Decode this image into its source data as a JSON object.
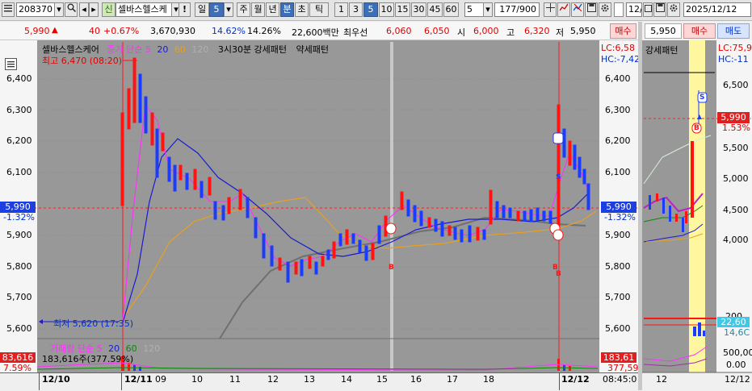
{
  "toolbar": {
    "code": "208370",
    "stock_name": "셀바스헬스케",
    "bang": "!",
    "period_options": [
      "일",
      "5",
      "주",
      "월",
      "년",
      "분",
      "초",
      "틱"
    ],
    "period_selected": "5",
    "minute_options": [
      "1",
      "3",
      "5",
      "10",
      "15",
      "30",
      "45",
      "60"
    ],
    "minute_selected": "5",
    "interval_value": "5",
    "count": "177/900",
    "right_input": "12/",
    "date": "2025/12/12"
  },
  "quote": {
    "price": "5,990",
    "change": "40",
    "change_pct": "+0.67%",
    "volume": "3,670,930",
    "rate1": "14.62%",
    "rate2": "14.26%",
    "amount": "22,600백만",
    "best_label": "최우선",
    "best_ask": "6,060",
    "best_bid": "6,050",
    "open_label": "시",
    "open": "6,000",
    "high_label": "고",
    "high": "6,320",
    "low_label": "저",
    "low": "5,950",
    "buy_button": "매수",
    "side_price": "5,950",
    "side_buy": "매수",
    "side_sell": "매도"
  },
  "main_chart": {
    "legend_name": "셀바스헬스케어",
    "legend_ma": "종가 단순",
    "legend_periods": [
      "5",
      "20",
      "60",
      "120"
    ],
    "legend_pattern1": "3시30분 강세패턴",
    "legend_pattern2": "약세패턴",
    "high_note": "최고 6,470 (08:20)",
    "low_note": "최저 5,620 (17:35)",
    "lc": "LC:6,58",
    "hc": "HC:-7,42",
    "lc_right": "LC:6,58",
    "hc_right": "HC:-7,42",
    "y_ticks": [
      "6,400",
      "6,300",
      "6,200",
      "6,100",
      "6,000",
      "5,900",
      "5,800",
      "5,700",
      "5,600"
    ],
    "current_price_tag": "5,990",
    "current_pct": "-1.32%",
    "signals": [
      "S",
      "B",
      "B",
      "B"
    ],
    "volume_legend": "거래량 단순",
    "volume_periods": [
      "5",
      "20",
      "60",
      "120"
    ],
    "volume_value": "183,616주(377.59%)",
    "vol_tag_left": "83,616",
    "vol_pct_left": "7.59%",
    "vol_tag_right": "183,61",
    "vol_pct_right": "377,59",
    "x_labels": [
      "12/10",
      "12/11",
      "09",
      "10",
      "11",
      "12",
      "13",
      "14",
      "15",
      "16",
      "17",
      "18",
      "12/12"
    ],
    "time_label": "08:45:0"
  },
  "side_chart": {
    "title": "강세패턴",
    "lc": "LC:75,9",
    "hc": "HC:-11",
    "y_ticks": [
      "6,500",
      "5,500",
      "5,000",
      "4,500",
      "4,000"
    ],
    "price_tag": "5,990",
    "pct": "1.53%",
    "signals": [
      "S",
      "B"
    ],
    "vol_ticks": [
      "200",
      "500,00",
      "0.00"
    ],
    "vol_tag": "22,60",
    "vol_tag2": "14,6C",
    "x_labels": [
      "12",
      "12/12"
    ]
  },
  "colors": {
    "up": "#ff0000",
    "down": "#0000ff",
    "ma5": "#ff00ff",
    "ma20": "#0000cc",
    "ma60": "#e8a020",
    "ma120": "#7a7a7a",
    "highlight": "#fff7a0"
  }
}
